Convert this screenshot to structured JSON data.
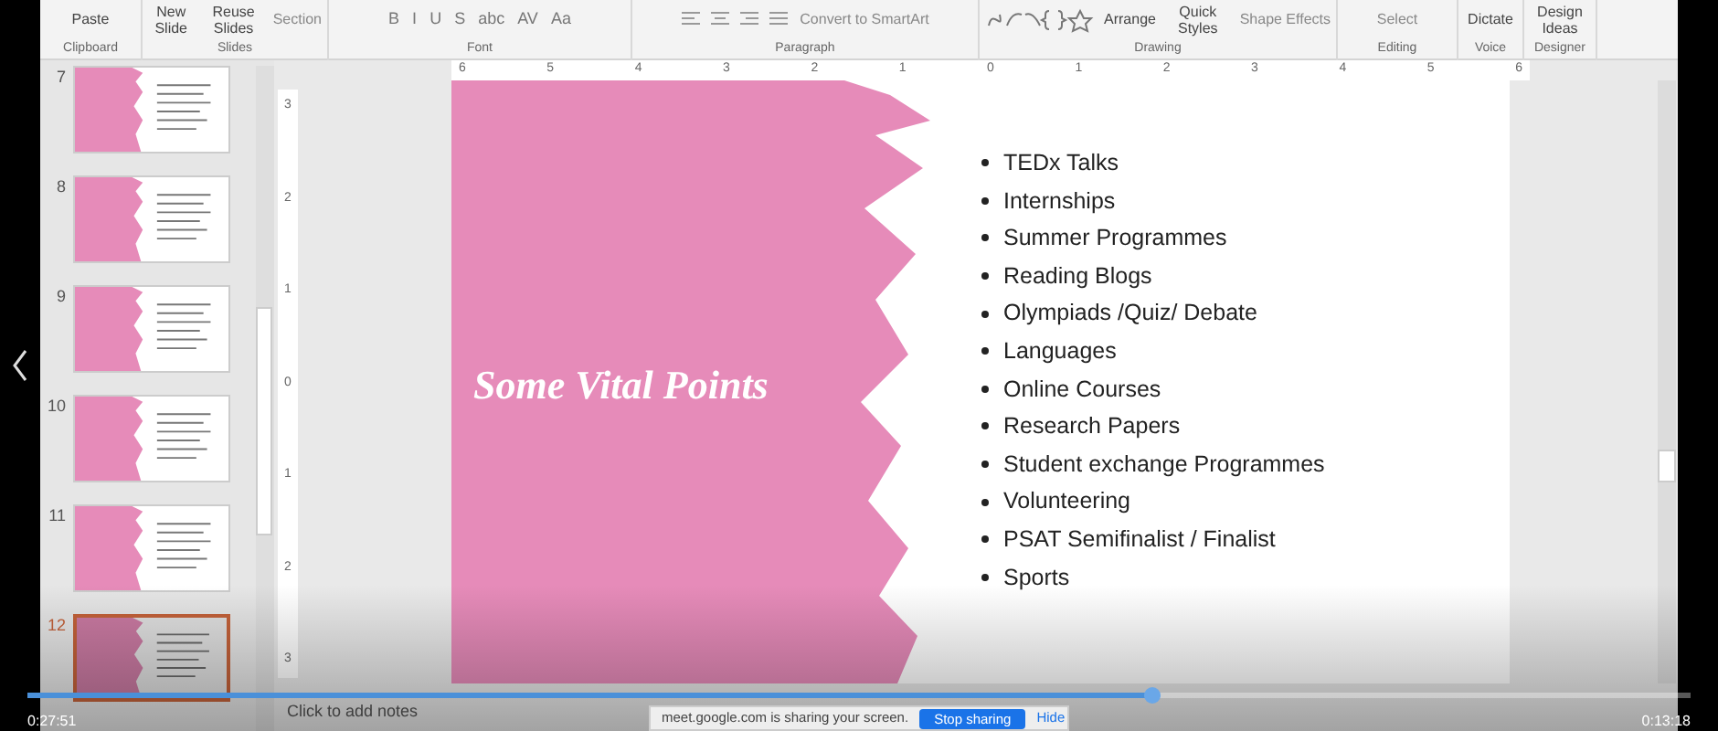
{
  "ribbon": {
    "groups": [
      {
        "label": "Clipboard",
        "items": [
          {
            "kind": "big",
            "label": "Paste"
          }
        ]
      },
      {
        "label": "Slides",
        "items": [
          {
            "kind": "big",
            "label": "New Slide"
          },
          {
            "kind": "big",
            "label": "Reuse Slides"
          },
          {
            "kind": "small",
            "label": "Section"
          }
        ]
      },
      {
        "label": "Font",
        "items": [
          {
            "kind": "glyph",
            "label": "B"
          },
          {
            "kind": "glyph",
            "label": "I"
          },
          {
            "kind": "glyph",
            "label": "U"
          },
          {
            "kind": "glyph",
            "label": "S"
          },
          {
            "kind": "glyph",
            "label": "abc"
          },
          {
            "kind": "glyph",
            "label": "AV"
          },
          {
            "kind": "glyph",
            "label": "Aa"
          }
        ]
      },
      {
        "label": "Paragraph",
        "items": [
          {
            "kind": "align"
          },
          {
            "kind": "small",
            "label": "Convert to SmartArt"
          }
        ]
      },
      {
        "label": "Drawing",
        "items": [
          {
            "kind": "shapes"
          },
          {
            "kind": "big",
            "label": "Arrange"
          },
          {
            "kind": "big",
            "label": "Quick Styles"
          },
          {
            "kind": "small",
            "label": "Shape Effects"
          }
        ]
      },
      {
        "label": "Editing",
        "items": [
          {
            "kind": "small",
            "label": "Select"
          }
        ]
      },
      {
        "label": "Voice",
        "items": [
          {
            "kind": "big",
            "label": "Dictate"
          }
        ]
      },
      {
        "label": "Designer",
        "items": [
          {
            "kind": "big",
            "label": "Design Ideas"
          }
        ]
      }
    ]
  },
  "thumbnails": [
    {
      "number": "7",
      "selected": false
    },
    {
      "number": "8",
      "selected": false
    },
    {
      "number": "9",
      "selected": false
    },
    {
      "number": "10",
      "selected": false
    },
    {
      "number": "11",
      "selected": false
    },
    {
      "number": "12",
      "selected": true
    }
  ],
  "horizontal_ruler": [
    "6",
    "5",
    "4",
    "3",
    "2",
    "1",
    "0",
    "1",
    "2",
    "3",
    "4",
    "5",
    "6"
  ],
  "vertical_ruler": [
    "3",
    "2",
    "1",
    "0",
    "1",
    "2",
    "3"
  ],
  "slide": {
    "title": "Some Vital Points",
    "bullets": [
      "TEDx Talks",
      "Internships",
      "Summer Programmes",
      "Reading Blogs",
      "Olympiads /Quiz/ Debate",
      "Languages",
      "Online Courses",
      "Research Papers",
      "Student exchange Programmes",
      "Volunteering",
      "PSAT Semifinalist / Finalist",
      "Sports"
    ]
  },
  "notes": {
    "placeholder": "Click to add notes"
  },
  "player": {
    "elapsed": "0:27:51",
    "remaining": "0:13:18",
    "level": 0.676
  },
  "share_bar": {
    "message": "meet.google.com is sharing your screen.",
    "stop": "Stop sharing",
    "hide": "Hide"
  }
}
